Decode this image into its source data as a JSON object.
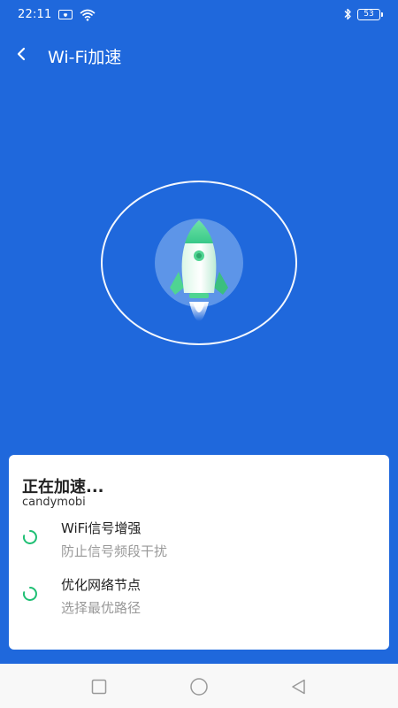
{
  "status_bar": {
    "time": "22:11",
    "battery_level": "53"
  },
  "header": {
    "title": "Wi-Fi加速",
    "back_icon": "back-arrow-icon"
  },
  "illustration": {
    "icon": "rocket-icon"
  },
  "card": {
    "title": "正在加速...",
    "subtitle": "candymobi",
    "items": [
      {
        "title": "WiFi信号增强",
        "description": "防止信号频段干扰",
        "icon": "spinner-icon"
      },
      {
        "title": "优化网络节点",
        "description": "选择最优路径",
        "icon": "spinner-icon"
      }
    ]
  },
  "nav": {
    "buttons": [
      "recent-apps-icon",
      "home-icon",
      "back-triangle-icon"
    ]
  },
  "colors": {
    "background": "#1f68dc",
    "accent_green": "#1fbf74",
    "card": "#ffffff"
  }
}
